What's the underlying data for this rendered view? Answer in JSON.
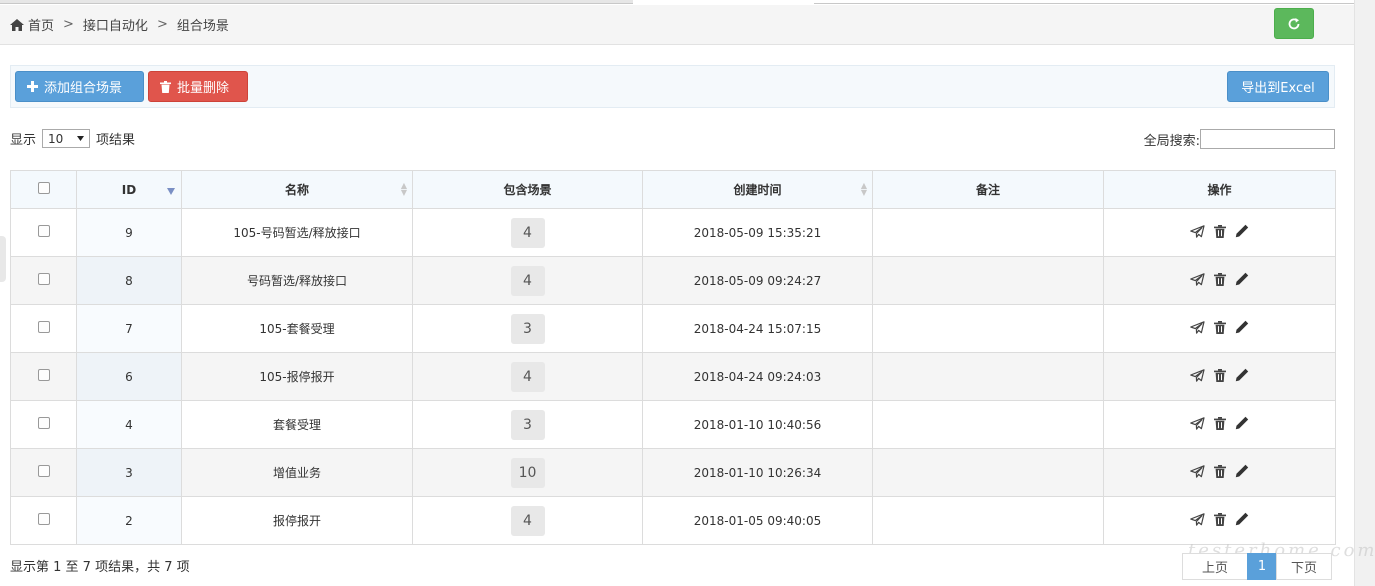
{
  "breadcrumb": {
    "home": "首页",
    "sep": ">",
    "level1": "接口自动化",
    "level2": "组合场景"
  },
  "toolbar": {
    "add_label": "添加组合场景",
    "delete_label": "批量删除",
    "export_label": "导出到Excel"
  },
  "length": {
    "prefix": "显示",
    "value": "10",
    "suffix": "项结果"
  },
  "search": {
    "label": "全局搜索:",
    "value": ""
  },
  "table": {
    "headers": [
      "ID",
      "名称",
      "包含场景",
      "创建时间",
      "备注",
      "操作"
    ],
    "rows": [
      {
        "id": "9",
        "name": "105-号码暂选/释放接口",
        "count": "4",
        "created": "2018-05-09 15:35:21",
        "note": ""
      },
      {
        "id": "8",
        "name": "号码暂选/释放接口",
        "count": "4",
        "created": "2018-05-09 09:24:27",
        "note": ""
      },
      {
        "id": "7",
        "name": "105-套餐受理",
        "count": "3",
        "created": "2018-04-24 15:07:15",
        "note": ""
      },
      {
        "id": "6",
        "name": "105-报停报开",
        "count": "4",
        "created": "2018-04-24 09:24:03",
        "note": ""
      },
      {
        "id": "4",
        "name": "套餐受理",
        "count": "3",
        "created": "2018-01-10 10:40:56",
        "note": ""
      },
      {
        "id": "3",
        "name": "增值业务",
        "count": "10",
        "created": "2018-01-10 10:26:34",
        "note": ""
      },
      {
        "id": "2",
        "name": "报停报开",
        "count": "4",
        "created": "2018-01-05 09:40:05",
        "note": ""
      }
    ]
  },
  "footer": {
    "info": "显示第 1 至 7 项结果，共 7 项",
    "prev": "上页",
    "current": "1",
    "next": "下页"
  },
  "watermark": "testerhome.com",
  "colors": {
    "primary": "#5aa0da",
    "danger": "#e0554c",
    "success": "#5cb85c"
  }
}
